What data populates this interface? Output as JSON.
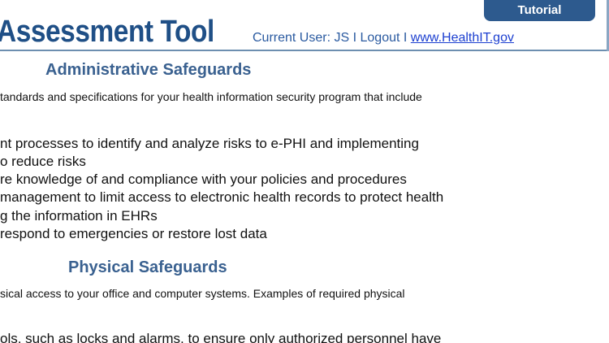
{
  "header": {
    "app_title": "Assessment Tool",
    "current_user_label": "Current User: JS",
    "separator": "I",
    "logout_label": "Logout",
    "site_link": "www.HealthIT.gov",
    "tutorial_label": "Tutorial"
  },
  "sections": [
    {
      "heading": "Administrative Safeguards",
      "intro": "tandards and specifications for your health information security program that include",
      "lines": [
        "nt processes to identify and analyze risks to e-PHI and implementing",
        "o reduce risks",
        "re knowledge of and compliance with your policies and procedures",
        "management to limit access to electronic health records to protect health",
        "g the information in EHRs",
        " respond to emergencies or restore lost data"
      ]
    },
    {
      "heading": "Physical Safeguards",
      "intro": "sical access to your office and computer systems. Examples of required physical",
      "lines": [
        "ols, such as locks and alarms, to ensure only authorized personnel have"
      ]
    }
  ],
  "colors": {
    "title_blue": "#1f4f86",
    "heading_blue": "#3a6190",
    "tab_blue": "#2d5a8e",
    "link_blue": "#1c3fd0"
  }
}
